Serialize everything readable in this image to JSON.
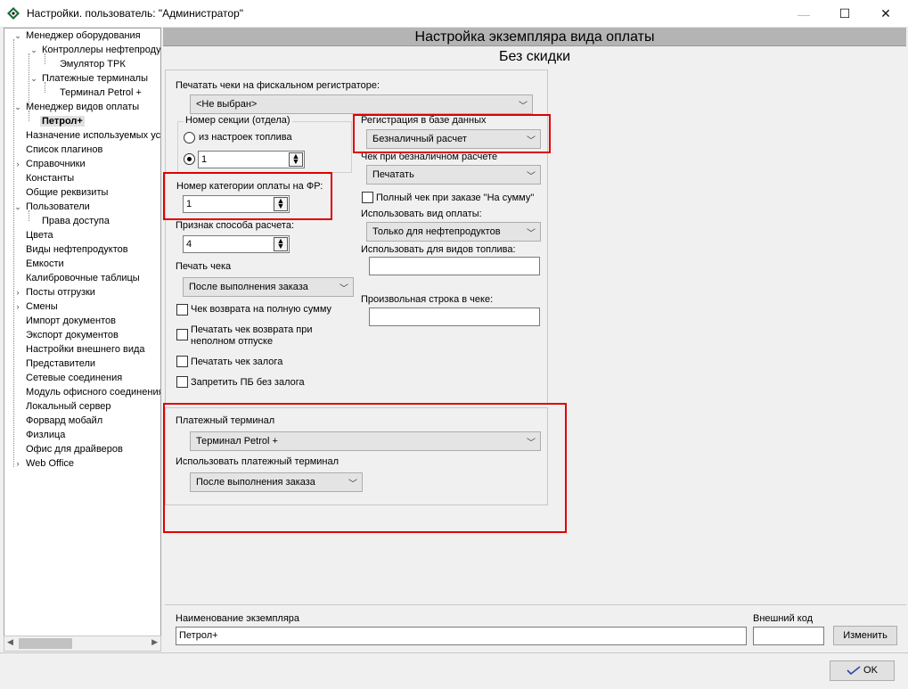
{
  "window": {
    "title": "Настройки. пользователь: \"Администратор\"",
    "controls": {
      "minimize": "—",
      "maximize": "☐",
      "close": "✕"
    }
  },
  "tree": {
    "nodes": [
      {
        "label": "Менеджер оборудования",
        "expander": "expanded"
      },
      {
        "label": "Контроллеры нефтепродуктов",
        "expander": "expanded"
      },
      {
        "label": "Эмулятор ТРК"
      },
      {
        "label": "Платежные терминалы",
        "expander": "expanded"
      },
      {
        "label": "Терминал Petrol +"
      },
      {
        "label": "Менеджер видов оплаты",
        "expander": "expanded"
      },
      {
        "label": "Петрол+",
        "selected": true
      },
      {
        "label": "Назначение используемых устройств"
      },
      {
        "label": "Список плагинов"
      },
      {
        "label": "Справочники",
        "expander": "collapsed"
      },
      {
        "label": "Константы"
      },
      {
        "label": "Общие реквизиты"
      },
      {
        "label": "Пользователи",
        "expander": "expanded"
      },
      {
        "label": "Права доступа"
      },
      {
        "label": "Цвета"
      },
      {
        "label": "Виды нефтепродуктов"
      },
      {
        "label": "Емкости"
      },
      {
        "label": "Калибровочные таблицы"
      },
      {
        "label": "Посты отгрузки",
        "expander": "collapsed"
      },
      {
        "label": "Смены",
        "expander": "collapsed"
      },
      {
        "label": "Импорт документов"
      },
      {
        "label": "Экспорт документов"
      },
      {
        "label": "Настройки внешнего вида"
      },
      {
        "label": "Представители"
      },
      {
        "label": "Сетевые соединения"
      },
      {
        "label": "Модуль офисного соединения"
      },
      {
        "label": "Локальный сервер"
      },
      {
        "label": "Форвард мобайл"
      },
      {
        "label": "Физлица"
      },
      {
        "label": "Офис для драйверов"
      },
      {
        "label": "Web Office",
        "expander": "collapsed"
      }
    ]
  },
  "header": {
    "title": "Настройка экземпляра вида оплаты",
    "subtitle": "Без скидки"
  },
  "form": {
    "fiscal_label": "Печатать чеки на фискальном регистраторе:",
    "fiscal_value": "<Не выбран>",
    "section_group_label": "Номер секции (отдела)",
    "section_from_fuel": "из настроек топлива",
    "section_value": "1",
    "category_label": "Номер категории оплаты на ФР:",
    "category_value": "1",
    "method_label": "Признак способа расчета:",
    "method_value": "4",
    "print_label": "Печать чека",
    "print_value": "После выполнения заказа",
    "check_full_return": "Чек возврата на полную сумму",
    "check_partial_return_1": "Печатать чек возврата при",
    "check_partial_return_2": "неполном отпуске",
    "check_deposit": "Печатать чек залога",
    "check_forbid_pb": "Запретить ПБ без залога",
    "reg_db_label": "Регистрация в базе данных",
    "reg_db_value": "Безналичный расчет",
    "noncash_label": "Чек при безналичном расчете",
    "noncash_value": "Печатать",
    "full_check_sum": "Полный чек при заказе \"На сумму\"",
    "use_payment_label": "Использовать вид оплаты:",
    "use_payment_value": "Только для нефтепродуктов",
    "use_fuel_label": "Использовать для видов топлива:",
    "use_fuel_value": "",
    "custom_line_label": "Произвольная строка в чеке:",
    "custom_line_value": ""
  },
  "terminal": {
    "label": "Платежный терминал",
    "value": "Терминал Petrol +",
    "use_label": "Использовать платежный терминал",
    "use_value": "После выполнения заказа"
  },
  "bottom": {
    "name_label": "Наименование экземпляра",
    "name_value": "Петрол+",
    "ext_code_label": "Внешний код",
    "ext_code_value": "",
    "change_button": "Изменить",
    "ok_button": "OK"
  }
}
